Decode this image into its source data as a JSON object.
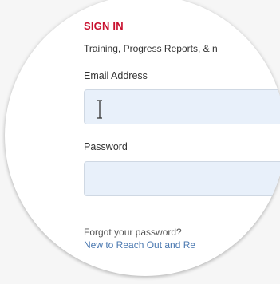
{
  "signin": {
    "heading": "SIGN IN",
    "subtitle": "Training, Progress Reports, & n",
    "email_label": "Email Address",
    "password_label": "Password",
    "forgot_link": "Forgot your password?",
    "register_link": "New to Reach Out and Re"
  },
  "colors": {
    "accent": "#c8102e",
    "link": "#4a78b0",
    "input_fill": "#e8f0fa"
  },
  "icons": {
    "text_cursor": "text-cursor-icon"
  }
}
